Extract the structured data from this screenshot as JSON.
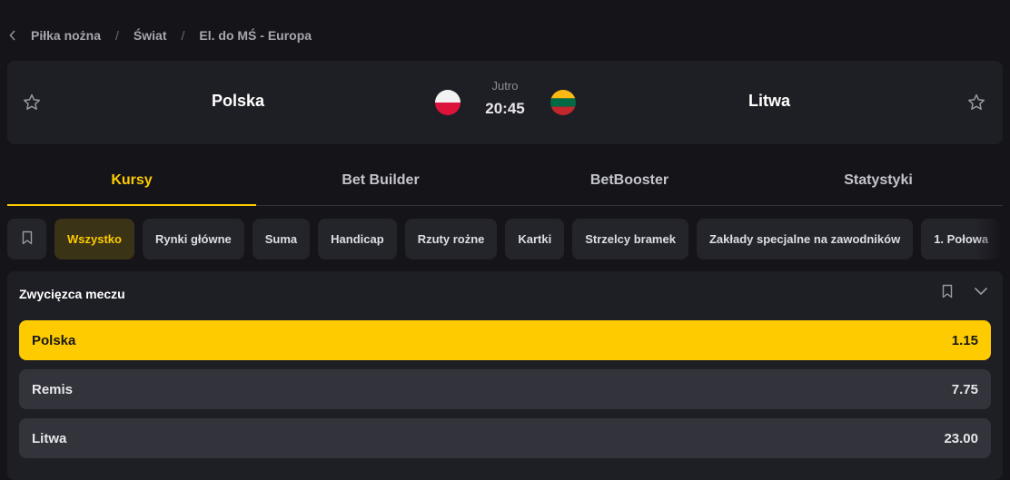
{
  "breadcrumb": {
    "items": [
      "Piłka nożna",
      "Świat",
      "El. do MŚ - Europa"
    ],
    "separator": "/"
  },
  "event": {
    "home_team": "Polska",
    "away_team": "Litwa",
    "day": "Jutro",
    "time": "20:45"
  },
  "tabs": [
    {
      "label": "Kursy",
      "active": true
    },
    {
      "label": "Bet Builder",
      "active": false
    },
    {
      "label": "BetBooster",
      "active": false
    },
    {
      "label": "Statystyki",
      "active": false
    }
  ],
  "chips": [
    {
      "label": "Wszystko",
      "active": true
    },
    {
      "label": "Rynki główne"
    },
    {
      "label": "Suma"
    },
    {
      "label": "Handicap"
    },
    {
      "label": "Rzuty rożne"
    },
    {
      "label": "Kartki"
    },
    {
      "label": "Strzelcy bramek"
    },
    {
      "label": "Zakłady specjalne na zawodników"
    },
    {
      "label": "1. Połowa"
    }
  ],
  "market": {
    "title": "Zwycięzca meczu",
    "outcomes": [
      {
        "label": "Polska",
        "odds": "1.15",
        "selected": true
      },
      {
        "label": "Remis",
        "odds": "7.75",
        "selected": false
      },
      {
        "label": "Litwa",
        "odds": "23.00",
        "selected": false
      }
    ]
  },
  "colors": {
    "accent": "#fdcb00",
    "background": "#141419",
    "card": "#1e1e25",
    "chip": "#24242b",
    "outcome": "#33333b"
  },
  "icons": [
    "chevron-left-icon",
    "star-icon",
    "bookmark-icon",
    "chevron-down-icon"
  ]
}
